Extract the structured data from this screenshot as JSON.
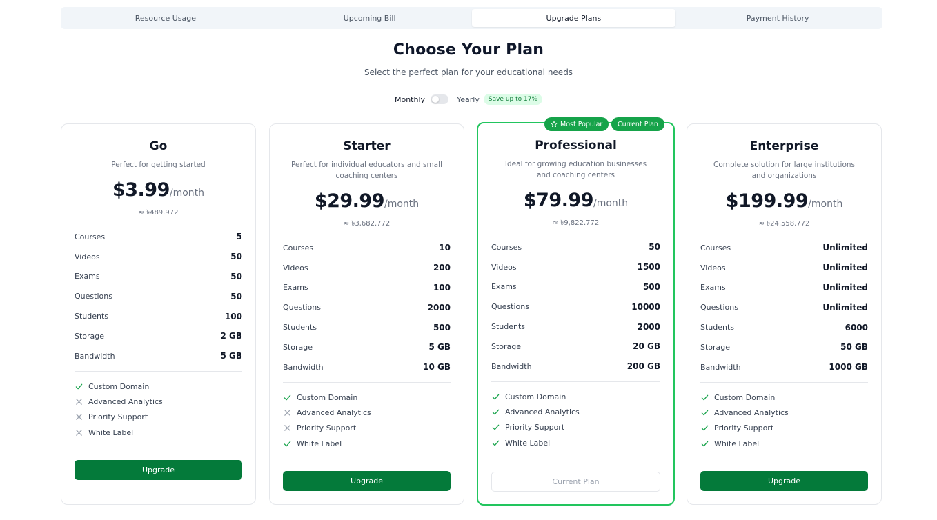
{
  "tabs": [
    {
      "label": "Resource Usage"
    },
    {
      "label": "Upcoming Bill"
    },
    {
      "label": "Upgrade Plans"
    },
    {
      "label": "Payment History"
    }
  ],
  "heading": {
    "title": "Choose Your Plan",
    "subtitle": "Select the perfect plan for your educational needs"
  },
  "billing": {
    "monthly_label": "Monthly",
    "yearly_label": "Yearly",
    "save_label": "Save up to 17%"
  },
  "badges": {
    "popular": "Most Popular",
    "current": "Current Plan"
  },
  "limit_labels": [
    "Courses",
    "Videos",
    "Exams",
    "Questions",
    "Students",
    "Storage",
    "Bandwidth"
  ],
  "feature_labels": [
    "Custom Domain",
    "Advanced Analytics",
    "Priority Support",
    "White Label"
  ],
  "colors": {
    "accent": "#047a3a",
    "highlight": "#22c55e",
    "badge": "#16a34a"
  },
  "plans": [
    {
      "name": "Go",
      "description": "Perfect for getting started",
      "price": "$3.99",
      "period": "/month",
      "converted": "≈ ৳489.972",
      "limits": [
        "5",
        "50",
        "50",
        "50",
        "100",
        "2 GB",
        "5 GB"
      ],
      "features": [
        true,
        false,
        false,
        false
      ],
      "button": "Upgrade"
    },
    {
      "name": "Starter",
      "description": "Perfect for individual educators and small coaching centers",
      "price": "$29.99",
      "period": "/month",
      "converted": "≈ ৳3,682.772",
      "limits": [
        "10",
        "200",
        "100",
        "2000",
        "500",
        "5 GB",
        "10 GB"
      ],
      "features": [
        true,
        false,
        false,
        true
      ],
      "button": "Upgrade"
    },
    {
      "name": "Professional",
      "description": "Ideal for growing education businesses and coaching centers",
      "price": "$79.99",
      "period": "/month",
      "converted": "≈ ৳9,822.772",
      "limits": [
        "50",
        "1500",
        "500",
        "10000",
        "2000",
        "20 GB",
        "200 GB"
      ],
      "features": [
        true,
        true,
        true,
        true
      ],
      "button": "Current Plan"
    },
    {
      "name": "Enterprise",
      "description": "Complete solution for large institutions and organizations",
      "price": "$199.99",
      "period": "/month",
      "converted": "≈ ৳24,558.772",
      "limits": [
        "Unlimited",
        "Unlimited",
        "Unlimited",
        "Unlimited",
        "6000",
        "50 GB",
        "1000 GB"
      ],
      "features": [
        true,
        true,
        true,
        true
      ],
      "button": "Upgrade"
    }
  ]
}
